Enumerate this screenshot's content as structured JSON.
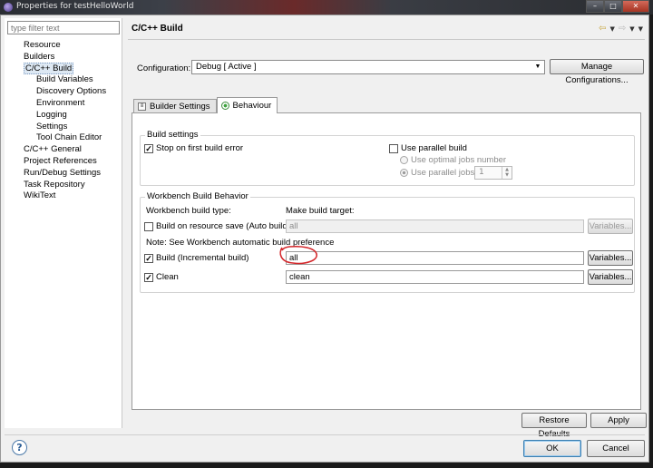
{
  "window": {
    "title": "Properties for testHelloWorld",
    "controls": [
      "–",
      "□",
      "✕"
    ]
  },
  "left_panel": {
    "filter_placeholder": "type filter text",
    "tree": [
      {
        "label": "Resource",
        "level": 0
      },
      {
        "label": "Builders",
        "level": 0
      },
      {
        "label": "C/C++ Build",
        "level": 0,
        "selected": true
      },
      {
        "label": "Build Variables",
        "level": 1
      },
      {
        "label": "Discovery Options",
        "level": 1
      },
      {
        "label": "Environment",
        "level": 1
      },
      {
        "label": "Logging",
        "level": 1
      },
      {
        "label": "Settings",
        "level": 1
      },
      {
        "label": "Tool Chain Editor",
        "level": 1
      },
      {
        "label": "C/C++ General",
        "level": 0
      },
      {
        "label": "Project References",
        "level": 0
      },
      {
        "label": "Run/Debug Settings",
        "level": 0
      },
      {
        "label": "Task Repository",
        "level": 0
      },
      {
        "label": "WikiText",
        "level": 0
      }
    ]
  },
  "header": {
    "title": "C/C++ Build",
    "icons": [
      "back-arrow-icon",
      "forward-arrow-icon",
      "view-menu-icon"
    ]
  },
  "configuration": {
    "label": "Configuration:",
    "value": "Debug  [ Active ]",
    "manage_button": "Manage Configurations..."
  },
  "tabs": [
    {
      "label": "Builder Settings",
      "icon": "builder-settings-icon",
      "active": false
    },
    {
      "label": "Behaviour",
      "icon": "behaviour-radio-icon",
      "active": true
    }
  ],
  "build_settings": {
    "group_label": "Build settings",
    "stop_on_error": {
      "label": "Stop on first build error",
      "checked": true
    },
    "use_parallel": {
      "label": "Use parallel build",
      "checked": false
    },
    "optimal_jobs": {
      "label": "Use optimal jobs number",
      "selected": false
    },
    "parallel_jobs": {
      "label": "Use parallel jobs:",
      "selected": true,
      "value": "1"
    }
  },
  "workbench": {
    "group_label": "Workbench Build Behavior",
    "build_type_label": "Workbench build type:",
    "make_target_label": "Make build target:",
    "rows": [
      {
        "label": "Build on resource save (Auto build)",
        "checked": false,
        "value": "all",
        "enabled": false
      },
      {
        "label": "Build (Incremental build)",
        "checked": true,
        "value": "all",
        "enabled": true
      },
      {
        "label": "Clean",
        "checked": true,
        "value": "clean",
        "enabled": true
      }
    ],
    "note": "Note: See Workbench automatic build preference",
    "variables_button": "Variables..."
  },
  "footer": {
    "restore_defaults": "Restore Defaults",
    "apply": "Apply",
    "ok": "OK",
    "cancel": "Cancel",
    "help_glyph": "?"
  },
  "colors": {
    "annotation_circle": "#d3262a",
    "selection_bg": "#dde8f3",
    "dialog_bg": "#f0f0f0"
  }
}
